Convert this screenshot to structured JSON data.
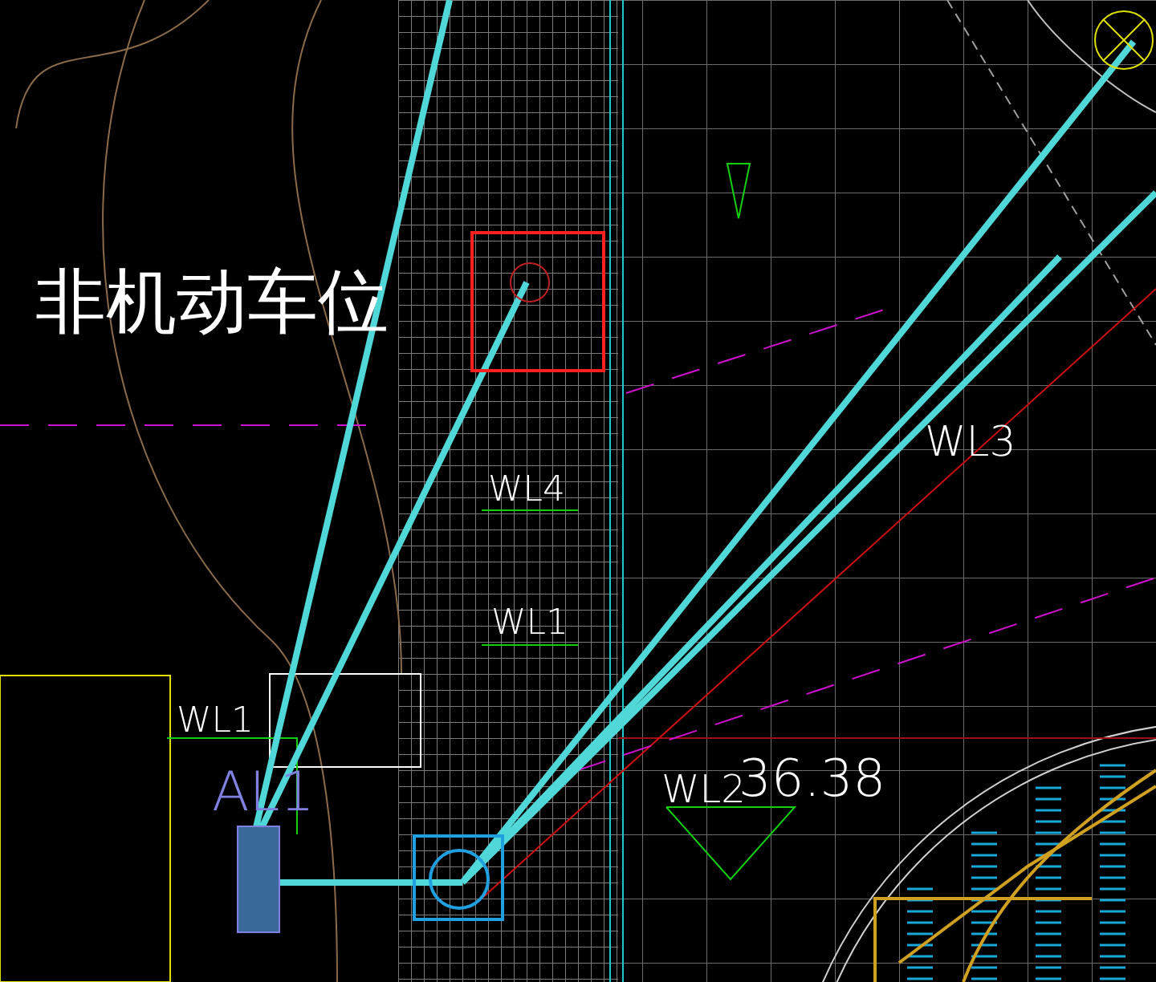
{
  "drawing": {
    "labels": [
      {
        "text": "非机动车位"
      },
      {
        "text": "WL4"
      },
      {
        "text": "WL1"
      },
      {
        "text": "WL1"
      },
      {
        "text": "AL1"
      },
      {
        "text": "WL2"
      },
      {
        "text": "36.38"
      },
      {
        "text": "WL3"
      }
    ]
  }
}
